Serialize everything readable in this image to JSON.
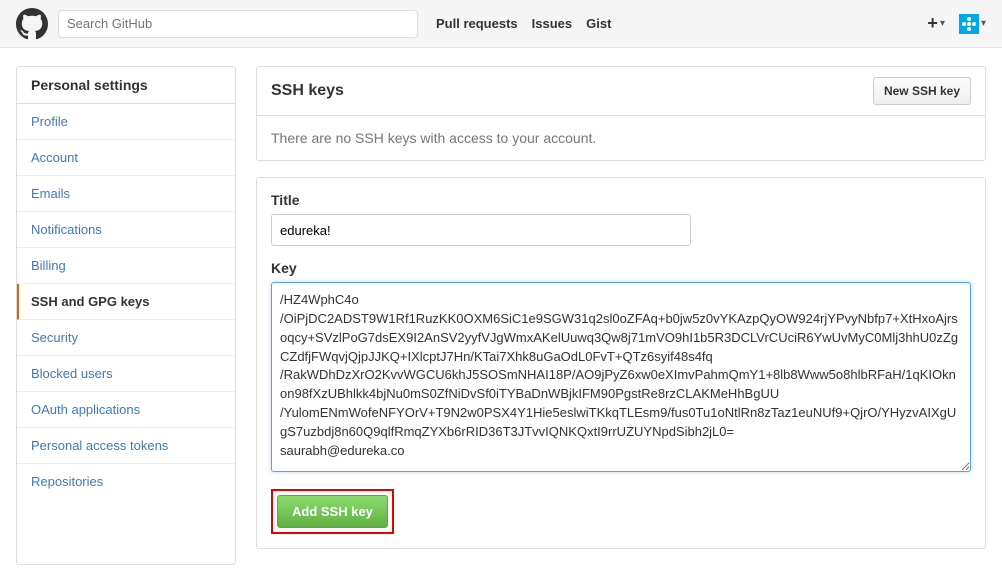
{
  "header": {
    "search_placeholder": "Search GitHub",
    "nav": {
      "pull": "Pull requests",
      "issues": "Issues",
      "gist": "Gist"
    }
  },
  "sidebar": {
    "head": "Personal settings",
    "items": [
      {
        "label": "Profile",
        "active": false
      },
      {
        "label": "Account",
        "active": false
      },
      {
        "label": "Emails",
        "active": false
      },
      {
        "label": "Notifications",
        "active": false
      },
      {
        "label": "Billing",
        "active": false
      },
      {
        "label": "SSH and GPG keys",
        "active": true
      },
      {
        "label": "Security",
        "active": false
      },
      {
        "label": "Blocked users",
        "active": false
      },
      {
        "label": "OAuth applications",
        "active": false
      },
      {
        "label": "Personal access tokens",
        "active": false
      },
      {
        "label": "Repositories",
        "active": false
      }
    ]
  },
  "ssh_panel": {
    "title": "SSH keys",
    "new_btn": "New SSH key",
    "empty_msg": "There are no SSH keys with access to your account."
  },
  "form": {
    "title_label": "Title",
    "title_value": "edureka!",
    "key_label": "Key",
    "key_value": "/HZ4WphC4o\n/OiPjDC2ADST9W1Rf1RuzKK0OXM6SiC1e9SGW31q2sl0oZFAq+b0jw5z0vYKAzpQyOW924rjYPvyNbfp7+XtHxoAjrsoqcy+SVzlPoG7dsEX9I2AnSV2yyfVJgWmxAKelUuwq3Qw8j71mVO9hI1b5R3DCLVrCUciR6YwUvMyC0Mlj3hhU0zZgCZdfjFWqvjQjpJJKQ+IXlcptJ7Hn/KTai7Xhk8uGaOdL0FvT+QTz6syif48s4fq\n/RakWDhDzXrO2KvvWGCU6khJ5SOSmNHAI18P/AO9jPyZ6xw0eXImvPahmQmY1+8lb8Www5o8hlbRFaH/1qKIOknon98fXzUBhlkk4bjNu0mS0ZfNiDvSf0iTYBaDnWBjkIFM90PgstRe8rzCLAKMeHhBgUU\n/YulomENmWofeNFYOrV+T9N2w0PSX4Y1Hie5eslwiTKkqTLEsm9/fus0Tu1oNtlRn8zTaz1euNUf9+QjrO/YHyzvAIXgUgS7uzbdj8n60Q9qlfRmqZYXb6rRID36T3JTvvIQNKQxtI9rrUZUYNpdSibh2jL0=\nsaurabh@edureka.co",
    "submit_label": "Add SSH key"
  }
}
